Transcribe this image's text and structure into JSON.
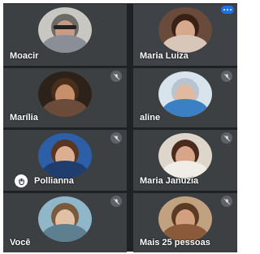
{
  "participants": [
    {
      "name": "Moacir",
      "muted": false
    },
    {
      "name": "Maria Luiza",
      "muted": false,
      "speaking": true
    },
    {
      "name": "Marília",
      "muted": true
    },
    {
      "name": "aline",
      "muted": true
    },
    {
      "name": "",
      "muted": true
    },
    {
      "name": "Maria Januzia",
      "muted": true
    },
    {
      "name": "Você",
      "muted": true
    },
    {
      "name": "Mais 25 pessoas",
      "muted": true
    }
  ],
  "raised_hand": {
    "name": "Pollianna"
  },
  "icons": {
    "mute": "mic-off-icon",
    "speaking": "audio-level-icon",
    "hand": "raised-hand-icon"
  },
  "colors": {
    "background": "#202124",
    "tile": "#3c4043",
    "accent": "#1a73e8"
  }
}
